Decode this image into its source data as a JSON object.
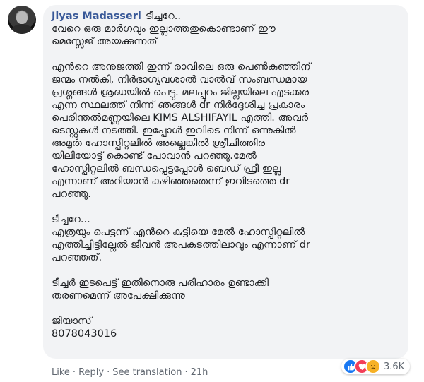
{
  "comment": {
    "author": "Jiyas Madasseri",
    "intro": "ടീച്ചറേ..",
    "paragraphs": [
      [
        "വേറെ ഒരു മാർഗവും ഇല്ലാത്തതുകൊണ്ടാണ് ഈ",
        "മെസ്സേജ് അയക്കുന്നത്"
      ],
      [
        "എൻറെ അനുജത്തി ഇന്ന് രാവിലെ ഒരു പെൺകുഞ്ഞിന്",
        "ജന്മം നൽകി, നിർഭാഗ്യവശാൽ വാൽവ് സംബന്ധമായ",
        "പ്രശ്നങ്ങൾ ശ്രദ്ധയിൽ പെട്ടു. മലപ്പുറം ജില്ലയിലെ എടക്കര",
        "എന്ന സ്ഥലത്ത് നിന്ന് ഞങ്ങൾ dr നിർദ്ദേശിച്ച പ്രകാരം",
        "പെരിന്തൽമണ്ണയിലെ KIMS ALSHIFAYIL എത്തി. അവർ",
        "ടെസ്റ്റുകൾ നടത്തി. ഇപ്പോൾ ഇവിടെ നിന്ന് ഒന്നുകിൽ",
        "അമൃത ഹോസ്പിറ്റലിൽ അല്ലെങ്കിൽ ശ്രീചിത്തിര",
        "യിലിയോട്ട് കൊണ്ട് പോവാൻ പറഞ്ഞു.മേൽ",
        "ഹോസ്പിറ്റലിൽ ബന്ധപ്പെട്ടപ്പോൾ ബെഡ് ഫ്രീ ഇല്ല",
        "എന്നാണ് അറിയാൻ കഴിഞ്ഞതെന്ന് ഇവിടത്തെ dr",
        "പറഞ്ഞു."
      ],
      [
        "ടീച്ചറേ...",
        "എത്രയും പെട്ടന്ന് എൻറെ കുട്ടിയെ മേൽ ഹോസ്പിറ്റലിൽ",
        "എത്തിച്ചിട്ടില്ലേൽ ജീവൻ അപകടത്തിലാവും എന്നാണ് dr",
        "പറഞ്ഞത്."
      ],
      [
        "ടീച്ചർ ഇടപെട്ട് ഇതിനൊരു പരിഹാരം ഉണ്ടാക്കി",
        "തരണമെന്ന് അപേക്ഷിക്കുന്നു"
      ],
      [
        "ജിയാസ്",
        "8078043016"
      ]
    ]
  },
  "actions": {
    "like": "Like",
    "reply": "Reply",
    "see_translation": "See translation",
    "time": "21h"
  },
  "reactions": {
    "count": "3.6K",
    "icons": [
      "like-icon",
      "love-icon",
      "sad-icon"
    ],
    "colors": {
      "like": "#1877f2",
      "love": "#f33e58",
      "sad": "#f7b125"
    }
  },
  "colors": {
    "author": "#385898",
    "bubble": "#f2f3f5",
    "meta_text": "#606770"
  }
}
